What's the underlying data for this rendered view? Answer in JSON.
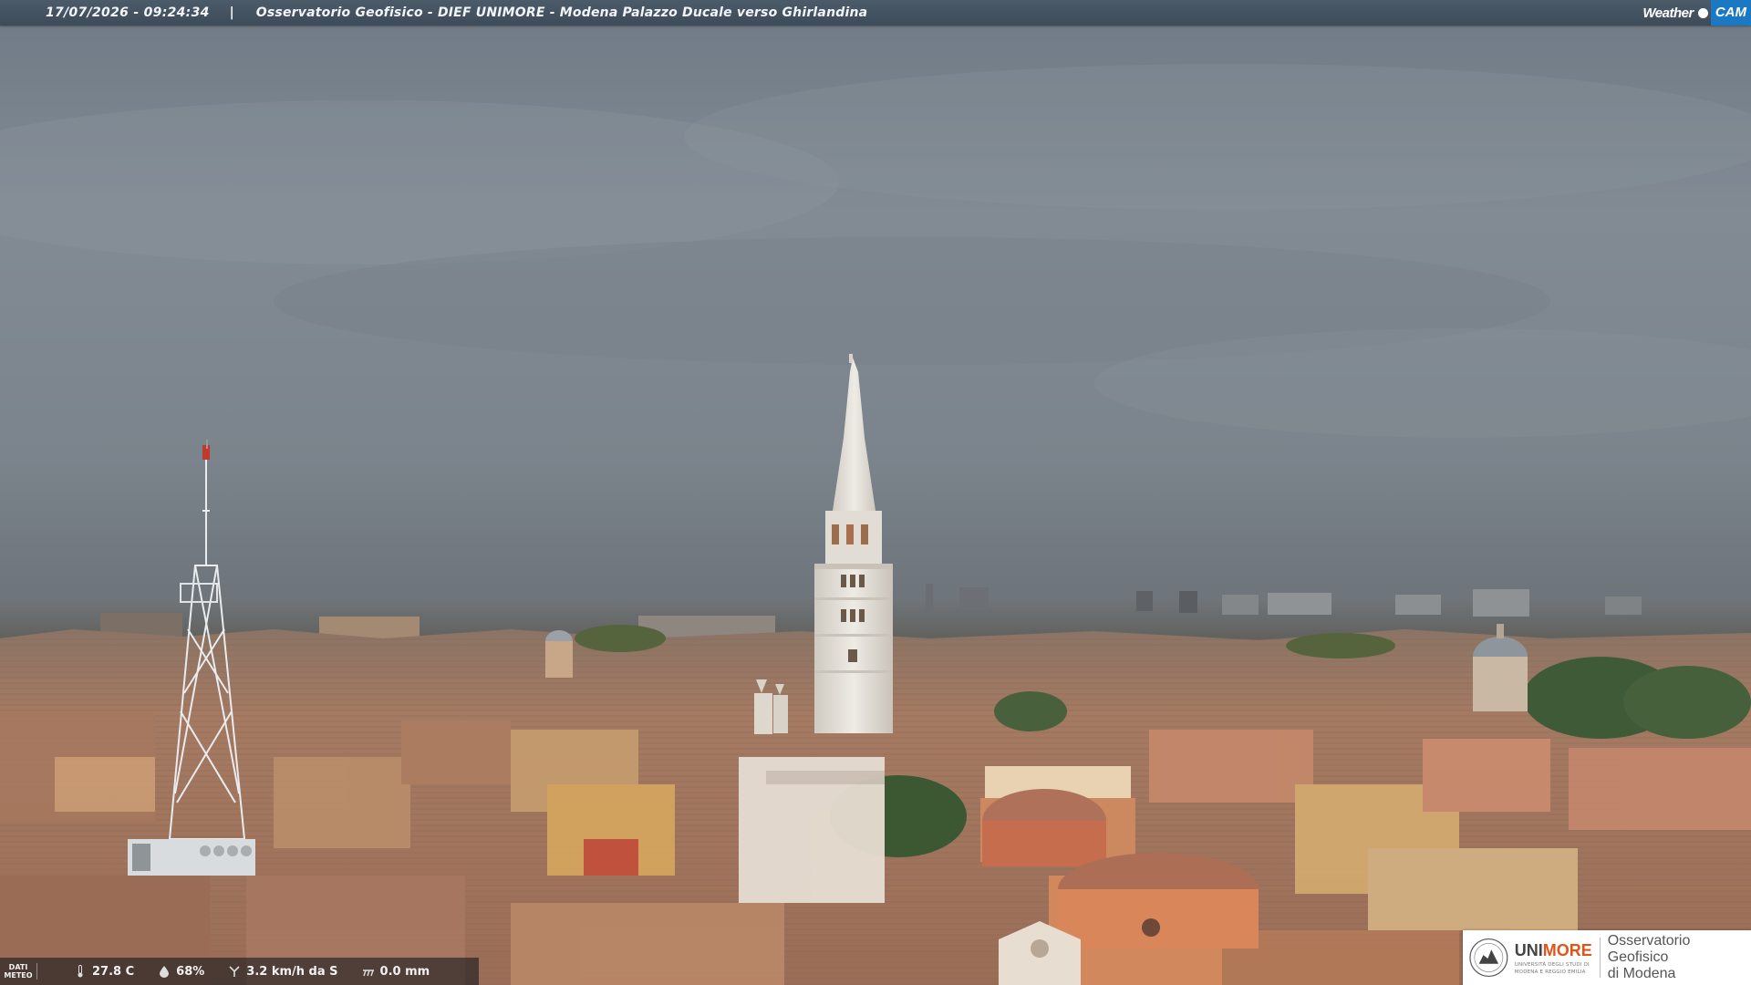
{
  "overlay": {
    "timestamp": "17/07/2026 - 09:24:34",
    "separator": "|",
    "title": "Osservatorio Geofisico - DIEF UNIMORE - Modena Palazzo Ducale verso Ghirlandina"
  },
  "brand": {
    "word": "Weather",
    "cam": "CAM"
  },
  "meteo": {
    "label_line1": "DATI",
    "label_line2": "METEO",
    "temperature": "27.8 C",
    "humidity": "68%",
    "wind": "3.2 km/h da S",
    "rain": "0.0 mm",
    "icons": [
      "thermometer-icon",
      "humidity-drop-icon",
      "wind-icon",
      "rain-icon"
    ]
  },
  "logo": {
    "name_part1": "UNI",
    "name_part2": "MORE",
    "subtitle_line1": "UNIVERSITÀ DEGLI STUDI DI",
    "subtitle_line2": "MODENA E REGGIO EMILIA",
    "observatory_line1": "Osservatorio Geofisico",
    "observatory_line2": "di Modena"
  },
  "colors": {
    "sky": "#7f8891",
    "roof": "#b9836b",
    "tower": "#e8e4dc",
    "brand_blue": "#1b78c2",
    "unimore_orange": "#e2531a"
  }
}
